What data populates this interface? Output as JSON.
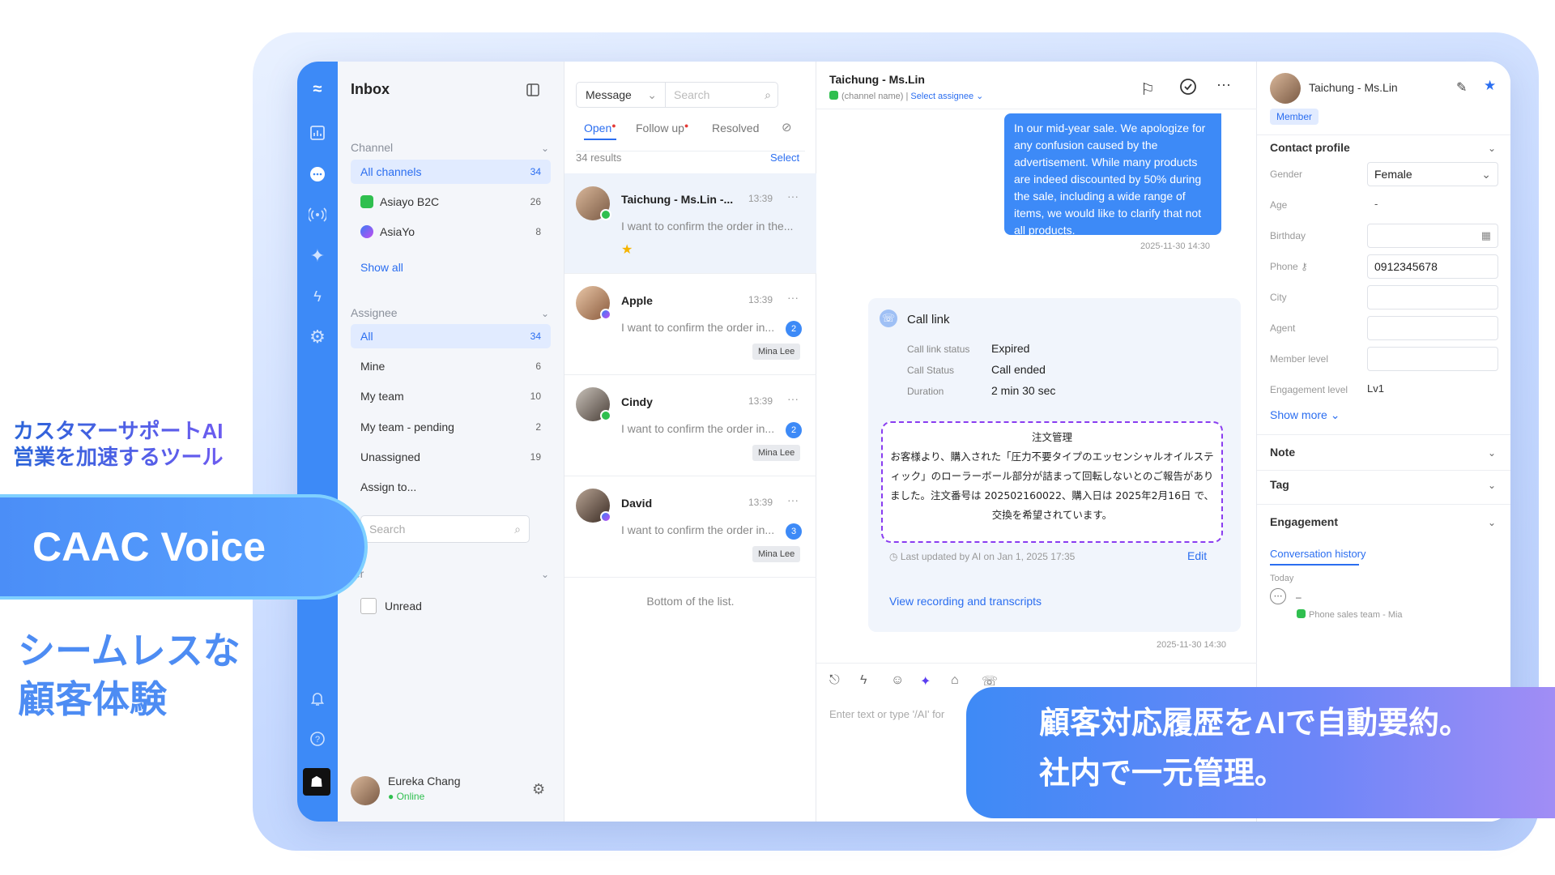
{
  "promo": {
    "tagline_line1": "カスタマーサポートAI",
    "tagline_line2": "営業を加速するツール",
    "product_name": "CAAC Voice",
    "catch_line1": "シームレスな",
    "catch_line2": "顧客体験",
    "banner_line1": "顧客対応履歴をAIで自動要約。",
    "banner_line2": "社内で一元管理。"
  },
  "colors": {
    "accent": "#3d8af7",
    "summary_border": "#8a3df0",
    "line_green": "#2fbf4f",
    "messenger": "#7a5cf0"
  },
  "rail": {
    "icons": [
      "logo-icon",
      "chart-icon",
      "chat-icon",
      "broadcast-icon",
      "sparkle-icon",
      "bolt-icon",
      "gear-icon",
      "bell-icon",
      "help-icon",
      "brand-badge-icon"
    ]
  },
  "inbox": {
    "title": "Inbox",
    "channel_section": "Channel",
    "channels": [
      {
        "label": "All channels",
        "count": "34"
      },
      {
        "label": "Asiayo B2C",
        "count": "26"
      },
      {
        "label": "AsiaYo",
        "count": "8"
      }
    ],
    "show_all": "Show all",
    "assignee_section": "Assignee",
    "assignees": [
      {
        "label": "All",
        "count": "34"
      },
      {
        "label": "Mine",
        "count": "6"
      },
      {
        "label": "My team",
        "count": "10"
      },
      {
        "label": "My team - pending",
        "count": "2"
      },
      {
        "label": "Unassigned",
        "count": "19"
      },
      {
        "label": "Assign to...",
        "count": ""
      }
    ],
    "search_placeholder": "Search",
    "filter_section": "ter",
    "unread_label": "Unread",
    "user_name": "Eureka Chang",
    "user_status": "● Online"
  },
  "list": {
    "type_select": "Message",
    "search_placeholder": "Search",
    "tabs": [
      "Open",
      "Follow up",
      "Resolved"
    ],
    "results": "34 results",
    "select_label": "Select",
    "conversations": [
      {
        "name": "Taichung - Ms.Lin -...",
        "time": "13:39",
        "preview": "I want to confirm the order in the...",
        "badge": "",
        "tag": ""
      },
      {
        "name": "Apple",
        "time": "13:39",
        "preview": "I want to confirm the order in...",
        "badge": "2",
        "tag": "Mina Lee"
      },
      {
        "name": "Cindy",
        "time": "13:39",
        "preview": "I want to confirm the order in...",
        "badge": "2",
        "tag": "Mina Lee"
      },
      {
        "name": "David",
        "time": "13:39",
        "preview": "I want to confirm the order in...",
        "badge": "3",
        "tag": "Mina Lee"
      }
    ],
    "bottom_text": "Bottom of the list."
  },
  "chat": {
    "title": "Taichung - Ms.Lin",
    "channel_name": "(channel name)",
    "select_assignee": "Select assignee",
    "bubble_text": "In our mid-year sale. We apologize for any confusion caused by the advertisement. While many products are indeed discounted by 50% during the sale, including a wide range of items, we would like to clarify that not all products.",
    "bubble_time": "2025-11-30 14:30",
    "call": {
      "title": "Call link",
      "rows": [
        {
          "label": "Call link status",
          "value": "Expired"
        },
        {
          "label": "Call Status",
          "value": "Call ended"
        },
        {
          "label": "Duration",
          "value": "2 min 30 sec"
        }
      ],
      "summary_title": "注文管理",
      "summary_body": "お客様より、購入された「圧力不要タイプのエッセンシャルオイルスティック」のローラーボール部分が詰まって回転しないとのご報告がありました。注文番号は 202502160022、購入日は 2025年2月16日 で、交換を希望されています。",
      "updated": "Last updated by AI on Jan 1, 2025 17:35",
      "edit": "Edit",
      "view_link": "View recording and transcripts"
    },
    "card_time": "2025-11-30 14:30",
    "input_placeholder": "Enter text or type '/AI' for"
  },
  "profile": {
    "name": "Taichung - Ms.Lin",
    "badge": "Member",
    "contact_section": "Contact profile",
    "fields": [
      {
        "label": "Gender",
        "value": "Female"
      },
      {
        "label": "Age",
        "value": "-"
      },
      {
        "label": "Birthday",
        "value": ""
      },
      {
        "label": "Phone",
        "value": "0912345678"
      },
      {
        "label": "City",
        "value": ""
      },
      {
        "label": "Agent",
        "value": ""
      },
      {
        "label": "Member level",
        "value": ""
      },
      {
        "label": "Engagement level",
        "value": "Lv1"
      }
    ],
    "show_more": "Show more",
    "note_section": "Note",
    "tag_section": "Tag",
    "engagement_section": "Engagement",
    "history_tab": "Conversation history",
    "today_label": "Today",
    "history_item": "Phone sales team - Mia"
  }
}
